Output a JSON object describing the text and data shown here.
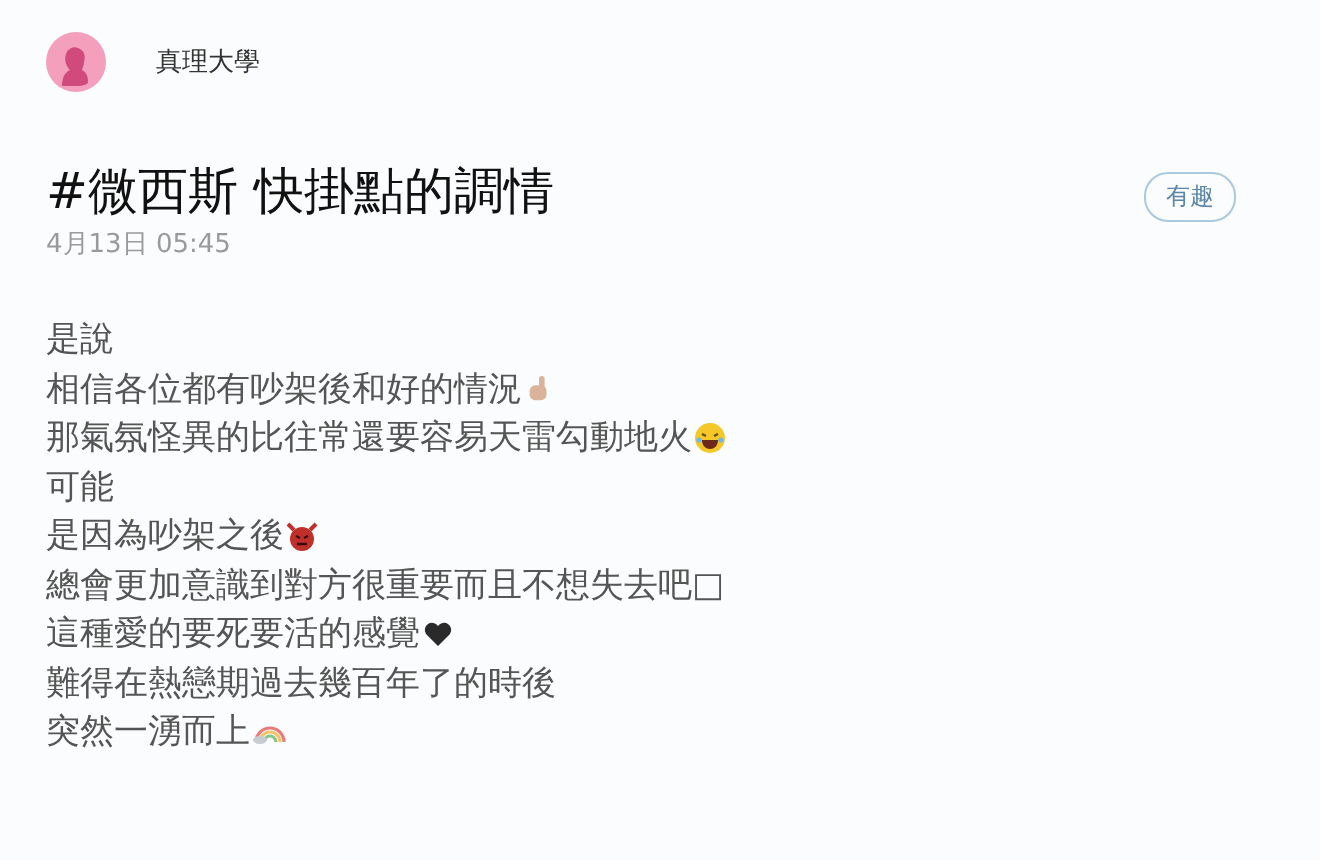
{
  "author": {
    "name": "真理大學"
  },
  "post": {
    "title": "#微西斯 快掛點的調情",
    "date": "4月13日 05:45",
    "tag": "有趣"
  },
  "lines": [
    {
      "text": "是說",
      "kind": "plain"
    },
    {
      "text": "相信各位都有吵架後和好的情況",
      "kind": "hand"
    },
    {
      "text": "那氣氛怪異的比往常還要容易天雷勾動地火",
      "kind": "laugh"
    },
    {
      "text": "可能",
      "kind": "plain"
    },
    {
      "text": "是因為吵架之後",
      "kind": "devil"
    },
    {
      "text": "總會更加意識到對方很重要而且不想失去吧□",
      "kind": "plain"
    },
    {
      "text": "這種愛的要死要活的感覺",
      "kind": "heart"
    },
    {
      "text": "難得在熱戀期過去幾百年了的時後",
      "kind": "plain"
    },
    {
      "text": "突然一湧而上",
      "kind": "rainbow"
    }
  ]
}
